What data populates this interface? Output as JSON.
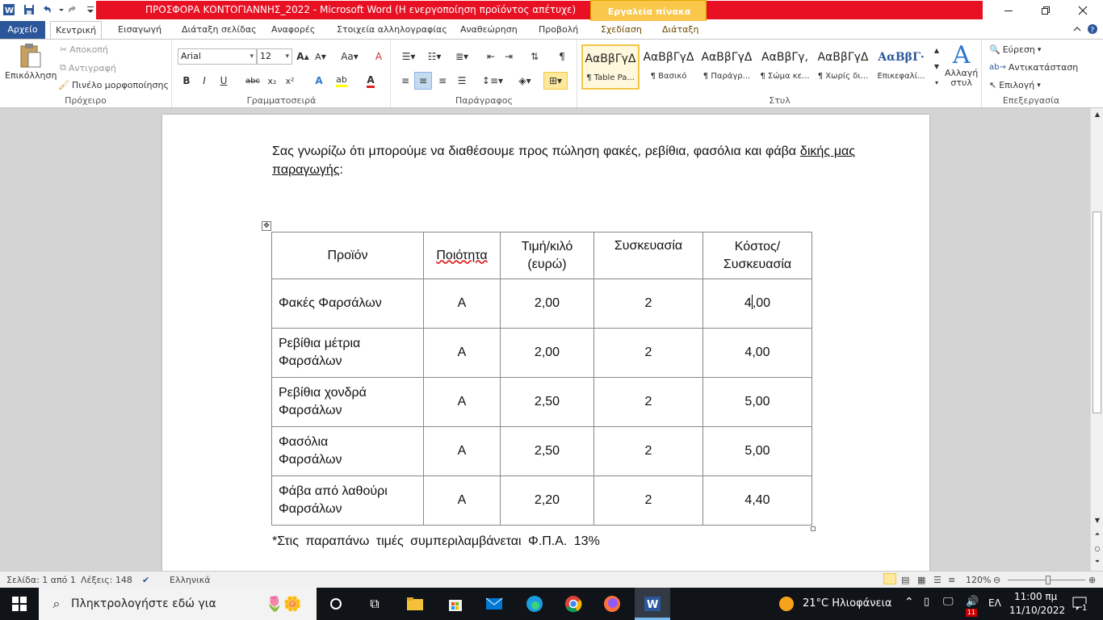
{
  "window": {
    "title": "ΠΡΟΣΦΟΡΑ ΚΟΝΤΟΓΙΑΝΝΗΣ_2022  -  Microsoft Word (Η ενεργοποίηση προϊόντος απέτυχε)",
    "context_group": "Εργαλεία πίνακα"
  },
  "tabs": [
    {
      "label": "Αρχείο"
    },
    {
      "label": "Κεντρική"
    },
    {
      "label": "Εισαγωγή"
    },
    {
      "label": "Διάταξη σελίδας"
    },
    {
      "label": "Αναφορές"
    },
    {
      "label": "Στοιχεία αλληλογραφίας"
    },
    {
      "label": "Αναθεώρηση"
    },
    {
      "label": "Προβολή"
    },
    {
      "label": "Σχεδίαση"
    },
    {
      "label": "Διάταξη"
    }
  ],
  "ribbon": {
    "clipboard": {
      "paste": "Επικόλληση",
      "cut": "Αποκοπή",
      "copy": "Αντιγραφή",
      "format_painter": "Πινέλο μορφοποίησης",
      "group": "Πρόχειρο"
    },
    "font": {
      "name": "Arial",
      "size": "12",
      "group": "Γραμματοσειρά"
    },
    "paragraph": {
      "group": "Παράγραφος"
    },
    "styles": {
      "items": [
        {
          "sample": "ΑαΒβΓγΔ",
          "name": "¶ Table Pa..."
        },
        {
          "sample": "ΑαΒβΓγΔ",
          "name": "¶ Βασικό"
        },
        {
          "sample": "ΑαΒβΓγΔ",
          "name": "¶ Παράγρ..."
        },
        {
          "sample": "ΑαΒβΓγ,",
          "name": "¶ Σώμα κε..."
        },
        {
          "sample": "ΑαΒβΓγΔ",
          "name": "¶ Χωρίς δι..."
        },
        {
          "sample": "ΑαΒβΓ·",
          "name": "Επικεφαλί..."
        }
      ],
      "change_styles_line1": "Αλλαγή",
      "change_styles_line2": "στυλ",
      "group": "Στυλ"
    },
    "editing": {
      "find": "Εύρεση",
      "replace": "Αντικατάσταση",
      "select": "Επιλογή",
      "group": "Επεξεργασία"
    }
  },
  "document": {
    "paragraph_start": "Σας γνωρίζω ότι μπορούμε να διαθέσουμε προς πώληση φακές, ρεβίθια, φασόλια και φάβα ",
    "paragraph_underlined": "δικής μας παραγωγής",
    "paragraph_end": ":",
    "table": {
      "headers": [
        "Προϊόν",
        "Ποιότητα",
        "Τιμή/κιλό (ευρώ)",
        "Συσκευασία",
        "Κόστος/ Συσκευασία"
      ],
      "rows": [
        [
          "Φακές  Φαρσάλων",
          "Α",
          "2,00",
          "2",
          "4,00"
        ],
        [
          "Ρεβίθια  μέτρια Φαρσάλων",
          "Α",
          "2,00",
          "2",
          "4,00"
        ],
        [
          "Ρεβίθια  χονδρά Φαρσάλων",
          "Α",
          "2,50",
          "2",
          "5,00"
        ],
        [
          "Φασόλια Φαρσάλων",
          "Α",
          "2,50",
          "2",
          "5,00"
        ],
        [
          "Φάβα από λαθούρι Φαρσάλων",
          "Α",
          "2,20",
          "2",
          "4,40"
        ]
      ]
    },
    "footnote": "*Στις παραπάνω τιμές συμπεριλαμβάνεται Φ.Π.Α. 13%"
  },
  "status": {
    "page": "Σελίδα: 1 από 1",
    "words": "Λέξεις: 148",
    "language": "Ελληνικά",
    "zoom": "120%",
    "zoom_percent": 120
  },
  "taskbar": {
    "search_placeholder": "Πληκτρολογήστε εδώ για",
    "weather": "21°C  Ηλιοφάνεια",
    "lang": "ΕΛ",
    "time": "11:00 πμ",
    "date": "11/10/2022",
    "notifications": "1",
    "badge": "11"
  },
  "colors": {
    "title_red": "#e81123",
    "context_gold": "#f9c74a",
    "word_blue": "#2b579a"
  }
}
